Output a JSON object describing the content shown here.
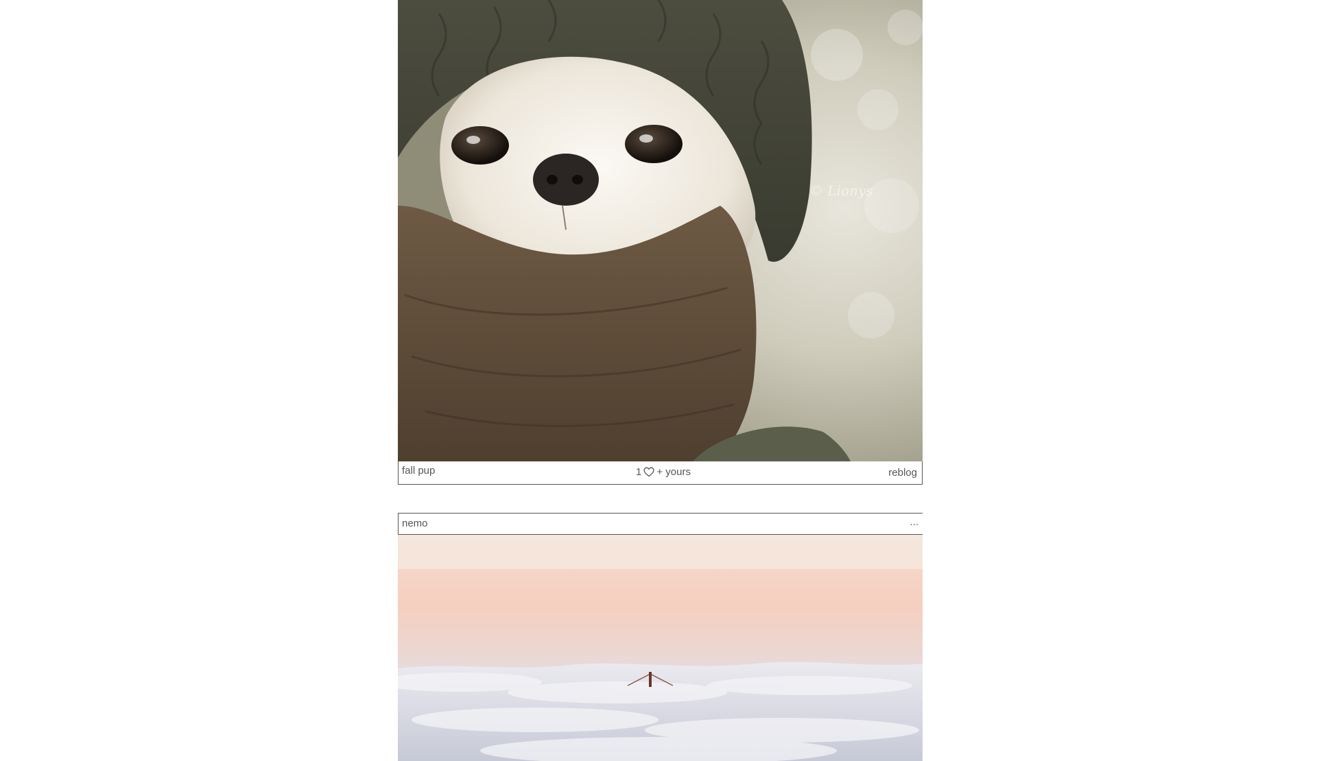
{
  "posts": [
    {
      "image_alt": "chihuahua wearing a knit hat and scarf",
      "caption": "fall pup",
      "notes": {
        "count": "1",
        "icon": "heart-icon",
        "suffix": "+ yours"
      },
      "reblog_label": "reblog"
    },
    {
      "author": "nemo",
      "more_label": "...",
      "image_alt": "bridge tower peeking above clouds at sunrise"
    }
  ],
  "colors": {
    "text": "#555555",
    "border": "#555555",
    "background": "#ffffff"
  }
}
